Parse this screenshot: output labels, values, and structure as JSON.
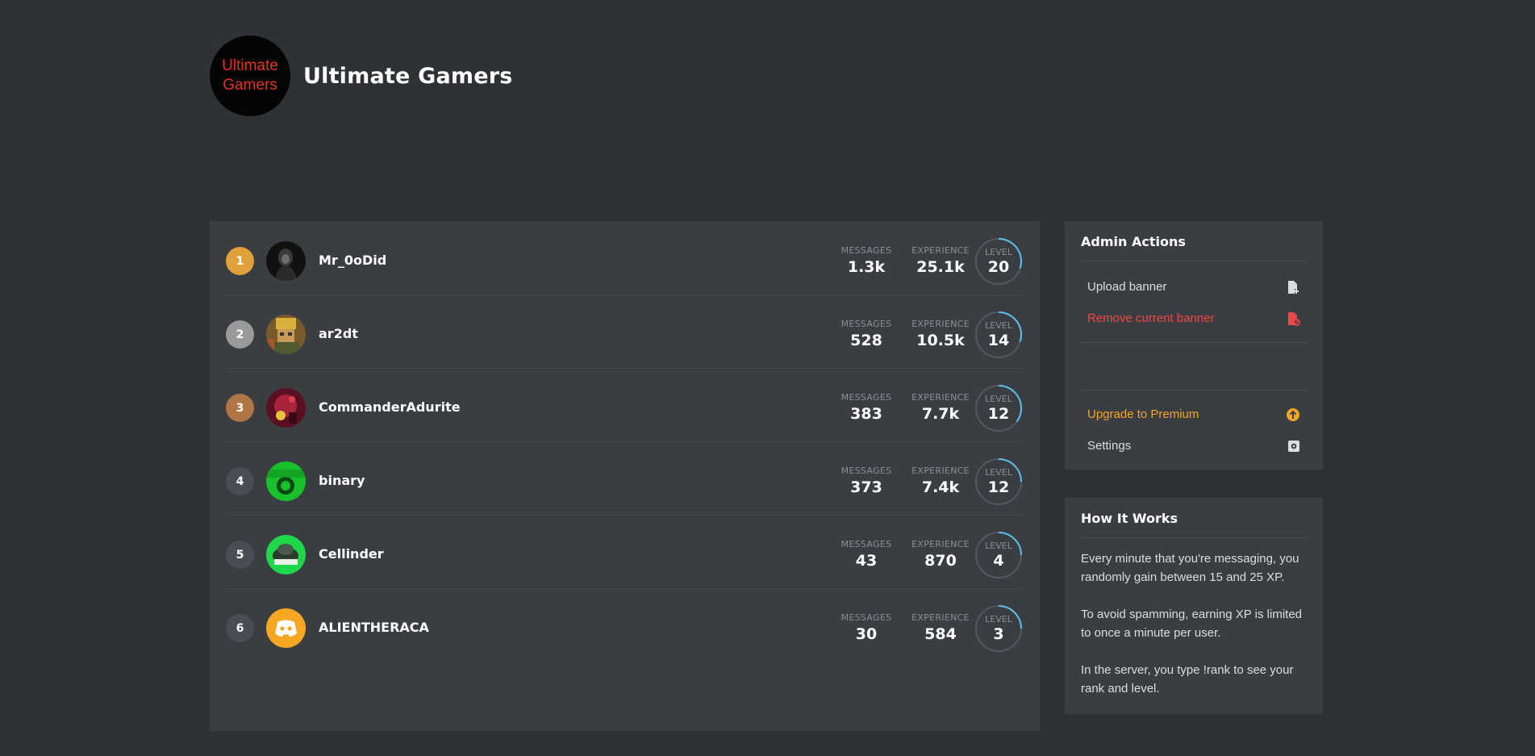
{
  "server": {
    "logo_line1": "Ultimate",
    "logo_line2": "Gamers",
    "name": "Ultimate Gamers"
  },
  "labels": {
    "messages": "MESSAGES",
    "experience": "EXPERIENCE",
    "level": "LEVEL"
  },
  "leaderboard": [
    {
      "rank": "1",
      "username": "Mr_0oDid",
      "messages": "1.3k",
      "experience": "25.1k",
      "level": "20",
      "level_progress": 0.3,
      "rank_color": "#e0a03a"
    },
    {
      "rank": "2",
      "username": "ar2dt",
      "messages": "528",
      "experience": "10.5k",
      "level": "14",
      "level_progress": 0.3,
      "rank_color": "#9a9a9a"
    },
    {
      "rank": "3",
      "username": "CommanderAdurite",
      "messages": "383",
      "experience": "7.7k",
      "level": "12",
      "level_progress": 0.35,
      "rank_color": "#b07545"
    },
    {
      "rank": "4",
      "username": "binary",
      "messages": "373",
      "experience": "7.4k",
      "level": "12",
      "level_progress": 0.25,
      "rank_color": "#4a4d53"
    },
    {
      "rank": "5",
      "username": "Cellinder",
      "messages": "43",
      "experience": "870",
      "level": "4",
      "level_progress": 0.25,
      "rank_color": "#4a4d53"
    },
    {
      "rank": "6",
      "username": "ALIENTHERACA",
      "messages": "30",
      "experience": "584",
      "level": "3",
      "level_progress": 0.25,
      "rank_color": "#4a4d53"
    }
  ],
  "admin": {
    "title": "Admin Actions",
    "upload_banner": "Upload banner",
    "remove_banner": "Remove current banner",
    "upgrade": "Upgrade to Premium",
    "settings": "Settings"
  },
  "how_it_works": {
    "title": "How It Works",
    "p1": "Every minute that you're messaging, you randomly gain between 15 and 25 XP.",
    "p2": "To avoid spamming, earning XP is limited to once a minute per user.",
    "p3": "In the server, you type !rank to see your rank and level."
  },
  "colors": {
    "background": "#2e3135",
    "card": "#3a3d42",
    "progress": "#5bc0eb",
    "danger": "#f04747",
    "premium": "#f5a623"
  },
  "icons": {
    "upload": "file-plus-icon",
    "remove": "file-remove-icon",
    "upgrade": "arrow-up-circle-icon",
    "settings": "gear-square-icon"
  }
}
